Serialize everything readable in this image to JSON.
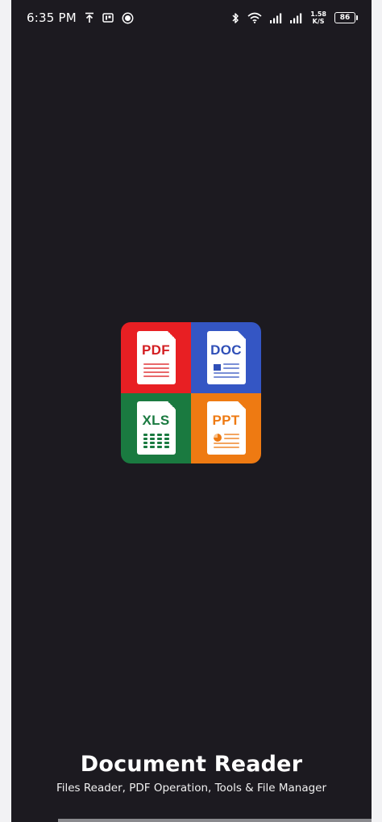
{
  "status_bar": {
    "time": "6:35 PM",
    "net_speed_value": "1.58",
    "net_speed_unit": "K/S",
    "battery": "86",
    "icons": [
      "upload-arrow-icon",
      "parking-app-icon",
      "circle-s-icon",
      "bluetooth-icon",
      "wifi-icon",
      "signal-icon",
      "signal-icon"
    ]
  },
  "logo": {
    "tiles": [
      {
        "label": "PDF",
        "color": "#e81f23"
      },
      {
        "label": "DOC",
        "color": "#3456c4"
      },
      {
        "label": "XLS",
        "color": "#1a7a40"
      },
      {
        "label": "PPT",
        "color": "#ee7a12"
      }
    ]
  },
  "splash": {
    "title": "Document Reader",
    "subtitle": "Files Reader, PDF Operation, Tools & File Manager"
  },
  "colors": {
    "background": "#1c1a20",
    "text": "#ffffff"
  }
}
